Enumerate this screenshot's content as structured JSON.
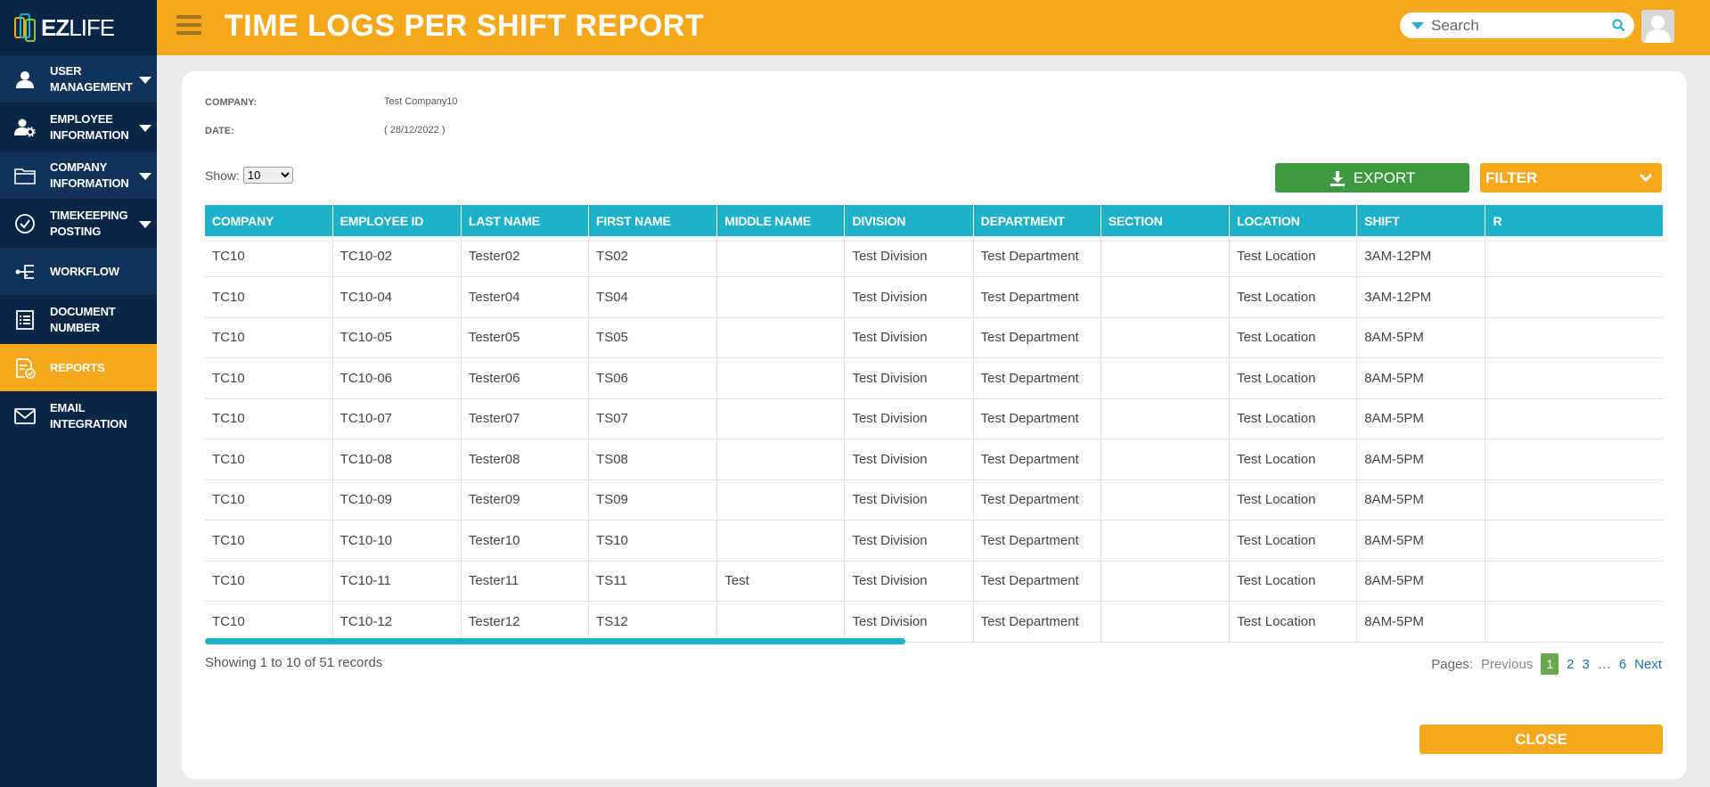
{
  "app": {
    "logo_ez": "EZ",
    "logo_life": "LIFE"
  },
  "sidebar": {
    "items": [
      {
        "label": "USER MANAGEMENT",
        "icon": "user-icon",
        "caret": true
      },
      {
        "label": "EMPLOYEE INFORMATION",
        "icon": "employee-settings-icon",
        "caret": true
      },
      {
        "label": "COMPANY INFORMATION",
        "icon": "folder-icon",
        "caret": true
      },
      {
        "label": "TIMEKEEPING POSTING",
        "icon": "check-circle-icon",
        "caret": true
      },
      {
        "label": "WORKFLOW",
        "icon": "workflow-icon",
        "caret": false
      },
      {
        "label": "DOCUMENT NUMBER",
        "icon": "document-list-icon",
        "caret": false
      },
      {
        "label": "REPORTS",
        "icon": "report-icon",
        "caret": false,
        "active": true
      },
      {
        "label": "EMAIL INTEGRATION",
        "icon": "mail-icon",
        "caret": false
      }
    ]
  },
  "header": {
    "title": "TIME LOGS PER SHIFT REPORT",
    "search_placeholder": "Search"
  },
  "report": {
    "company_label": "COMPANY:",
    "company_value": "Test Company10",
    "date_label": "DATE:",
    "date_value": "( 28/12/2022 )",
    "show_label": "Show:",
    "show_value": "10",
    "export_label": "EXPORT",
    "filter_label": "FILTER"
  },
  "table": {
    "columns": [
      "COMPANY",
      "EMPLOYEE ID",
      "LAST NAME",
      "FIRST NAME",
      "MIDDLE NAME",
      "DIVISION",
      "DEPARTMENT",
      "SECTION",
      "LOCATION",
      "SHIFT",
      "R"
    ],
    "rows": [
      [
        "TC10",
        "TC10-02",
        "Tester02",
        "TS02",
        "",
        "Test Division",
        "Test Department",
        "",
        "Test Location",
        "3AM-12PM",
        ""
      ],
      [
        "TC10",
        "TC10-04",
        "Tester04",
        "TS04",
        "",
        "Test Division",
        "Test Department",
        "",
        "Test Location",
        "3AM-12PM",
        ""
      ],
      [
        "TC10",
        "TC10-05",
        "Tester05",
        "TS05",
        "",
        "Test Division",
        "Test Department",
        "",
        "Test Location",
        "8AM-5PM",
        ""
      ],
      [
        "TC10",
        "TC10-06",
        "Tester06",
        "TS06",
        "",
        "Test Division",
        "Test Department",
        "",
        "Test Location",
        "8AM-5PM",
        ""
      ],
      [
        "TC10",
        "TC10-07",
        "Tester07",
        "TS07",
        "",
        "Test Division",
        "Test Department",
        "",
        "Test Location",
        "8AM-5PM",
        ""
      ],
      [
        "TC10",
        "TC10-08",
        "Tester08",
        "TS08",
        "",
        "Test Division",
        "Test Department",
        "",
        "Test Location",
        "8AM-5PM",
        ""
      ],
      [
        "TC10",
        "TC10-09",
        "Tester09",
        "TS09",
        "",
        "Test Division",
        "Test Department",
        "",
        "Test Location",
        "8AM-5PM",
        ""
      ],
      [
        "TC10",
        "TC10-10",
        "Tester10",
        "TS10",
        "",
        "Test Division",
        "Test Department",
        "",
        "Test Location",
        "8AM-5PM",
        ""
      ],
      [
        "TC10",
        "TC10-11",
        "Tester11",
        "TS11",
        "Test",
        "Test Division",
        "Test Department",
        "",
        "Test Location",
        "8AM-5PM",
        ""
      ],
      [
        "TC10",
        "TC10-12",
        "Tester12",
        "TS12",
        "",
        "Test Division",
        "Test Department",
        "",
        "Test Location",
        "8AM-5PM",
        ""
      ]
    ]
  },
  "footer": {
    "records_text": "Showing 1 to 10 of 51 records",
    "pages_label": "Pages:",
    "previous": "Previous",
    "pages": [
      "1",
      "2",
      "3",
      "…",
      "6"
    ],
    "current_page": "1",
    "next": "Next",
    "close_label": "CLOSE"
  },
  "colors": {
    "sidebar": "#0b2747",
    "accent": "#f5a81c",
    "table_header": "#1eb1c9",
    "export": "#3d9a40",
    "current_page": "#6aa84f"
  }
}
